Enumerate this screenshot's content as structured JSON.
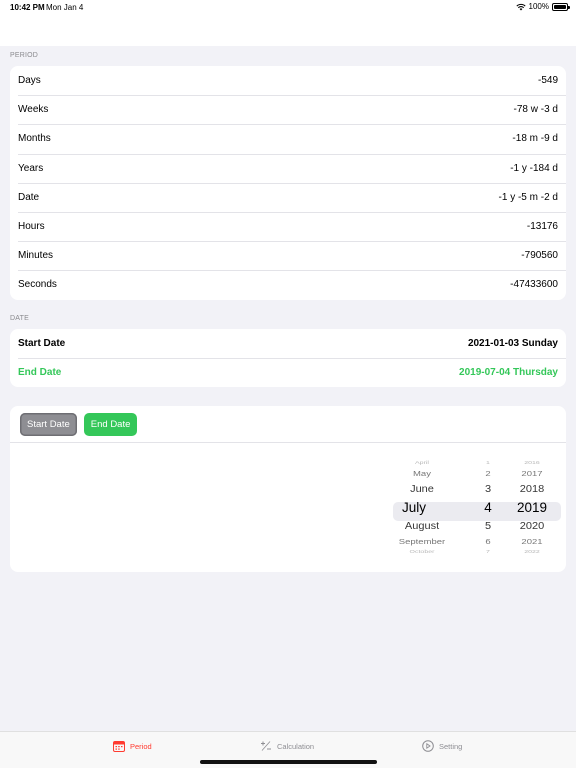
{
  "status_bar": {
    "time": "10:42 PM",
    "date": "Mon Jan 4",
    "battery": "100%"
  },
  "period": {
    "header": "PERIOD",
    "rows": [
      {
        "label": "Days",
        "value": "-549"
      },
      {
        "label": "Weeks",
        "value": "-78 w -3 d"
      },
      {
        "label": "Months",
        "value": "-18 m -9 d"
      },
      {
        "label": "Years",
        "value": "-1 y -184 d"
      },
      {
        "label": "Date",
        "value": "-1 y -5 m -2 d"
      },
      {
        "label": "Hours",
        "value": "-13176"
      },
      {
        "label": "Minutes",
        "value": "-790560"
      },
      {
        "label": "Seconds",
        "value": "-47433600"
      }
    ]
  },
  "date": {
    "header": "DATE",
    "start_label": "Start Date",
    "start_value": "2021-01-03 Sunday",
    "end_label": "End Date",
    "end_value": "2019-07-04 Thursday"
  },
  "picker": {
    "start_button": "Start Date",
    "end_button": "End Date",
    "rows": [
      {
        "month": "April",
        "day": "1",
        "year": "2016"
      },
      {
        "month": "May",
        "day": "2",
        "year": "2017"
      },
      {
        "month": "June",
        "day": "3",
        "year": "2018"
      },
      {
        "month": "July",
        "day": "4",
        "year": "2019"
      },
      {
        "month": "August",
        "day": "5",
        "year": "2020"
      },
      {
        "month": "September",
        "day": "6",
        "year": "2021"
      },
      {
        "month": "October",
        "day": "7",
        "year": "2022"
      }
    ]
  },
  "tabs": [
    {
      "label": "Period",
      "icon": "calendar-icon"
    },
    {
      "label": "Calculation",
      "icon": "plus-minus-icon"
    },
    {
      "label": "Setting",
      "icon": "play-circle-icon"
    }
  ],
  "colors": {
    "accent_green": "#34c759",
    "active_tab": "#ff3b30",
    "inactive": "#8e8e93"
  }
}
